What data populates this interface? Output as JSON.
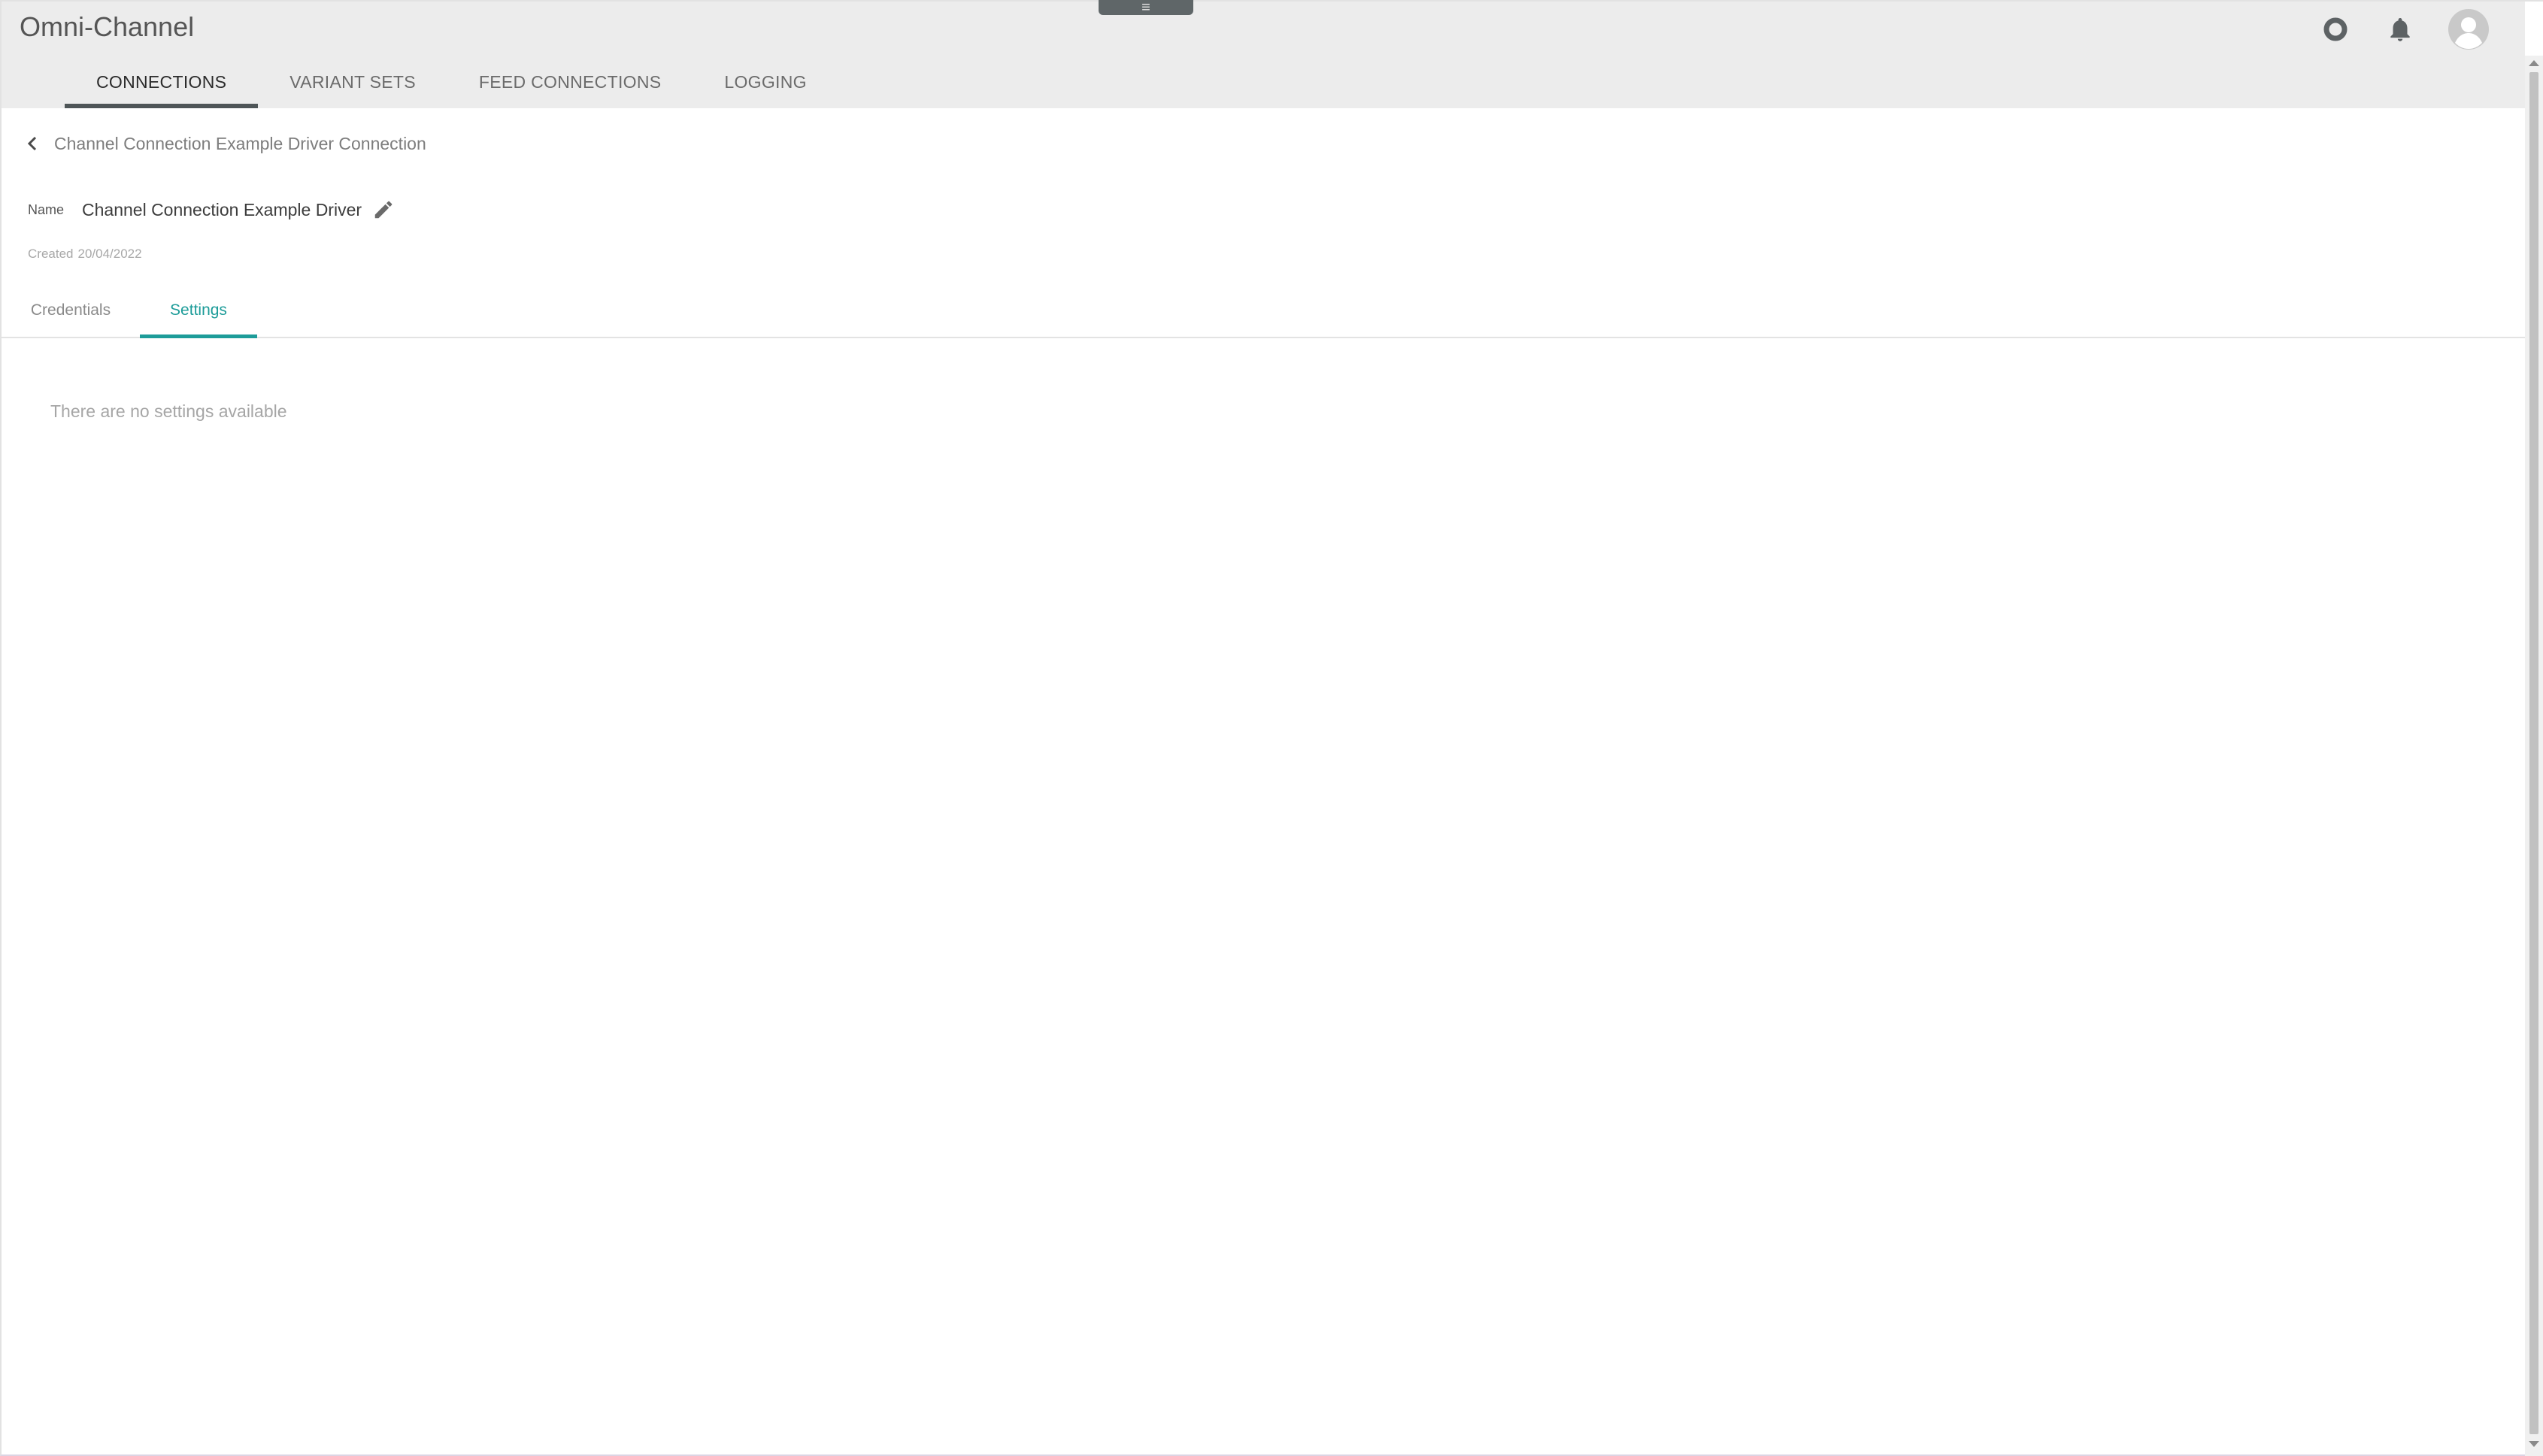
{
  "app": {
    "title": "Omni-Channel",
    "handle_icon": "menu-icon"
  },
  "main_tabs": [
    {
      "label": "CONNECTIONS",
      "active": true
    },
    {
      "label": "VARIANT SETS",
      "active": false
    },
    {
      "label": "FEED CONNECTIONS",
      "active": false
    },
    {
      "label": "LOGGING",
      "active": false
    }
  ],
  "top_icons": [
    "help-ring-icon",
    "bell-icon",
    "user-avatar-icon"
  ],
  "breadcrumb": {
    "back_icon": "chevron-left-icon",
    "text": "Channel Connection Example Driver Connection"
  },
  "detail": {
    "name_label": "Name",
    "name_value": "Channel Connection Example Driver",
    "edit_icon": "pencil-icon",
    "created_label": "Created",
    "created_date": "20/04/2022"
  },
  "sub_tabs": [
    {
      "label": "Credentials",
      "active": false
    },
    {
      "label": "Settings",
      "active": true
    }
  ],
  "settings": {
    "empty_message": "There are no settings available"
  },
  "colors": {
    "accent": "#1d9c99",
    "header_bg": "#ececec",
    "active_tab_underline": "#4e5557"
  }
}
